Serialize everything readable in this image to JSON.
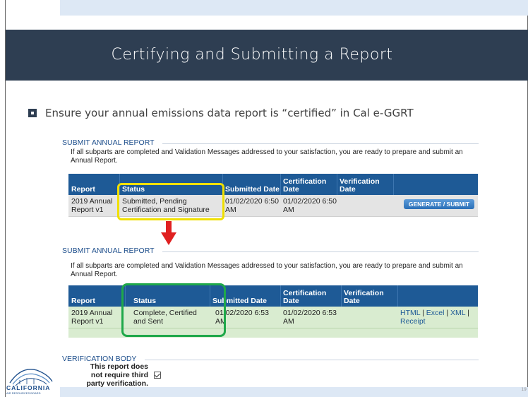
{
  "slide": {
    "title": "Certifying and Submitting a Report",
    "bullet": "Ensure your annual emissions data report is “certified” in Cal e-GGRT",
    "number": "19"
  },
  "colors": {
    "title_bar": "#2e3e52",
    "table_header": "#1e5a96",
    "row_fill": "#e4e4e4",
    "row_fill_complete": "#d9ecd0",
    "highlight_yellow": "#f0e000",
    "highlight_green": "#1fa84a",
    "arrow_red": "#e02020"
  },
  "panel_before": {
    "section_label": "SUBMIT ANNUAL REPORT",
    "intro": "If all subparts are completed and Validation Messages addressed to your satisfaction, you are ready to prepare and submit an Annual Report.",
    "headers": [
      "Report",
      "Status",
      "Submitted Date",
      "Certification Date",
      "Verification Date"
    ],
    "row": {
      "report": "2019 Annual Report v1",
      "status": "Submitted, Pending Certification and Signature",
      "submitted": "01/02/2020 6:50 AM",
      "certification": "01/02/2020 6:50 AM",
      "verification": ""
    },
    "action_button": "GENERATE / SUBMIT"
  },
  "panel_after": {
    "section_label": "SUBMIT ANNUAL REPORT",
    "intro": "If all subparts are completed and Validation Messages addressed to your satisfaction, you are ready to prepare and submit an Annual Report.",
    "headers": [
      "Report",
      "Status",
      "Submitted Date",
      "Certification Date",
      "Verification Date"
    ],
    "row": {
      "report": "2019 Annual Report v1",
      "status": "Complete, Certified and Sent",
      "submitted": "01/02/2020 6:53 AM",
      "certification": "01/02/2020 6:53 AM",
      "verification": ""
    },
    "links": [
      "HTML",
      "Excel",
      "XML",
      "Receipt"
    ]
  },
  "verification": {
    "section_label": "VERIFICATION BODY",
    "text": "This report does not require third party verification.",
    "checkbox_checked": true
  },
  "logo": {
    "name": "CALIFORNIA",
    "subtitle": "AIR RESOURCES BOARD"
  }
}
